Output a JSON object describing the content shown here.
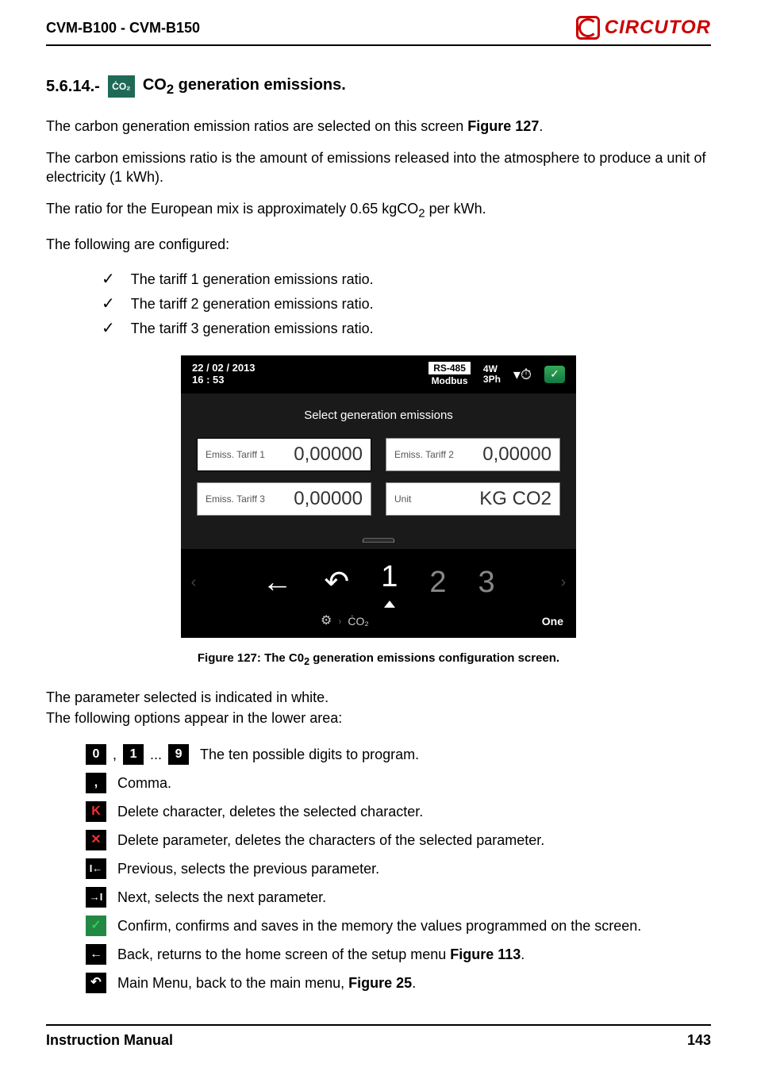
{
  "header": {
    "product_range": "CVM-B100 - CVM-B150",
    "brand": "CIRCUTOR"
  },
  "section": {
    "number": "5.6.14.-",
    "icon_label": "ĊO₂",
    "title_html": "CO",
    "title_sub": "2",
    "title_rest": " generation emissions."
  },
  "paragraphs": {
    "p1_pre": "The carbon generation emission ratios are selected on this screen ",
    "p1_fig": "Figure 127",
    "p1_post": ".",
    "p2": "The carbon emissions ratio is the amount of emissions released into the atmosphere to produce a unit of electricity (1 kWh).",
    "p3_pre": "The ratio for the European mix is approximately 0.65 kgCO",
    "p3_sub": "2",
    "p3_post": " per kWh.",
    "p4": "The following are configured:"
  },
  "checklist": [
    "The tariff 1 generation emissions ratio.",
    "The tariff 2 generation emissions ratio.",
    "The tariff 3 generation emissions ratio."
  ],
  "device": {
    "date": "22 / 02 / 2013",
    "time": "16 : 53",
    "rs_top": "RS-485",
    "rs_bot": "Modbus",
    "wiring_top": "4W",
    "wiring_bot": "3Ph",
    "body_title": "Select generation emissions",
    "fields": {
      "t1_label": "Emiss. Tariff 1",
      "t1_value": "0,00000",
      "t2_label": "Emiss. Tariff 2",
      "t2_value": "0,00000",
      "t3_label": "Emiss. Tariff 3",
      "t3_value": "0,00000",
      "unit_label": "Unit",
      "unit_value": "KG CO2"
    },
    "nav": {
      "back": "←",
      "undo": "↶",
      "d1": "1",
      "d2": "2",
      "d3": "3"
    },
    "bottom": {
      "co2": "ĊO₂",
      "one": "One"
    }
  },
  "caption_pre": "Figure 127: The C0",
  "caption_sub": "2",
  "caption_post": " generation emissions configuration screen.",
  "after_fig": {
    "l1": "The parameter selected is indicated in white.",
    "l2": "The following options appear in the lower area:"
  },
  "legend": {
    "digits": {
      "k0": "0",
      "k1": "1",
      "k9": "9",
      "text": "  The ten possible digits to program."
    },
    "comma": {
      "key": ",",
      "text": " Comma."
    },
    "delchar": {
      "key": "K",
      "text": " Delete character, deletes the selected character."
    },
    "delparam": {
      "key": "✕",
      "text": " Delete parameter, deletes the characters of the selected parameter."
    },
    "prev": {
      "key": "I←",
      "text": " Previous, selects the previous parameter."
    },
    "next": {
      "key": "→I",
      "text": " Next, selects the next parameter."
    },
    "confirm": {
      "key": "✓",
      "text": "Confirm, confirms and saves in the memory the values programmed on the screen."
    },
    "back": {
      "key": "←",
      "text": " Back, returns to the home screen of the setup menu ",
      "fig": "Figure 113",
      "post": "."
    },
    "main": {
      "key": "↶",
      "text": " Main Menu, back to the main menu, ",
      "fig": "Figure 25",
      "post": "."
    }
  },
  "footer": {
    "left": "Instruction Manual",
    "right": "143"
  }
}
